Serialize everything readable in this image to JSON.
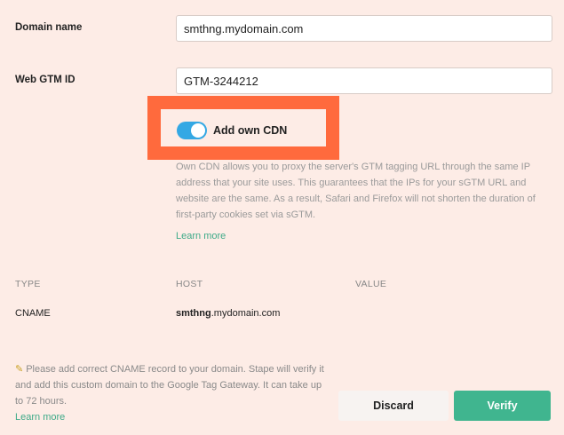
{
  "form": {
    "domain_label": "Domain name",
    "domain_value": "smthng.mydomain.com",
    "gtm_label": "Web GTM ID",
    "gtm_value": "GTM-3244212"
  },
  "cdn": {
    "toggle_label": "Add own CDN",
    "toggle_on": true,
    "description": "Own CDN allows you to proxy the server's GTM tagging URL through the same IP address that your site uses. This guarantees that the IPs for your sGTM URL and website are the same. As a result, Safari and Firefox will not shorten the duration of first-party cookies set via sGTM.",
    "learn_more": "Learn more"
  },
  "records": {
    "columns": [
      "TYPE",
      "HOST",
      "VALUE"
    ],
    "rows": [
      {
        "type": "CNAME",
        "host_bold": "smthng",
        "host_rest": ".mydomain.com",
        "value": ""
      }
    ]
  },
  "note": {
    "icon": "pencil-icon",
    "text": "Please add correct CNAME record to your domain. Stape will verify it and add this custom domain to the Google Tag Gateway. It can take up to 72 hours.",
    "learn_more": "Learn more"
  },
  "actions": {
    "discard_label": "Discard",
    "verify_label": "Verify"
  },
  "colors": {
    "background": "#fdece6",
    "highlight": "#ff6a3d",
    "toggle": "#34a8e4",
    "accent_green": "#40b58f",
    "link": "#3eaa88"
  }
}
